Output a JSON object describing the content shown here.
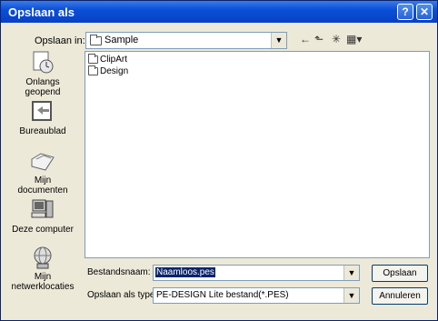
{
  "window": {
    "title": "Opslaan als",
    "help_glyph": "?",
    "close_glyph": "✕"
  },
  "location": {
    "label": "Opslaan in:",
    "value": "Sample"
  },
  "toolbar": {
    "back_glyph": "←",
    "up_glyph": "⬑",
    "new_folder_glyph": "✳",
    "views_glyph": "▦▾"
  },
  "places": [
    {
      "label": "Onlangs geopend",
      "icon": "recent-icon"
    },
    {
      "label": "Bureaublad",
      "icon": "desktop-icon"
    },
    {
      "label": "Mijn documenten",
      "icon": "my-documents-icon"
    },
    {
      "label": "Deze computer",
      "icon": "computer-icon"
    },
    {
      "label": "Mijn netwerklocaties",
      "icon": "network-icon"
    }
  ],
  "files": [
    {
      "name": "ClipArt"
    },
    {
      "name": "Design"
    }
  ],
  "filename": {
    "label": "Bestandsnaam:",
    "value": "Naamloos.pes"
  },
  "filetype": {
    "label": "Opslaan als type:",
    "value": "PE-DESIGN Lite bestand(*.PES)"
  },
  "buttons": {
    "save": "Opslaan",
    "cancel": "Annuleren"
  }
}
